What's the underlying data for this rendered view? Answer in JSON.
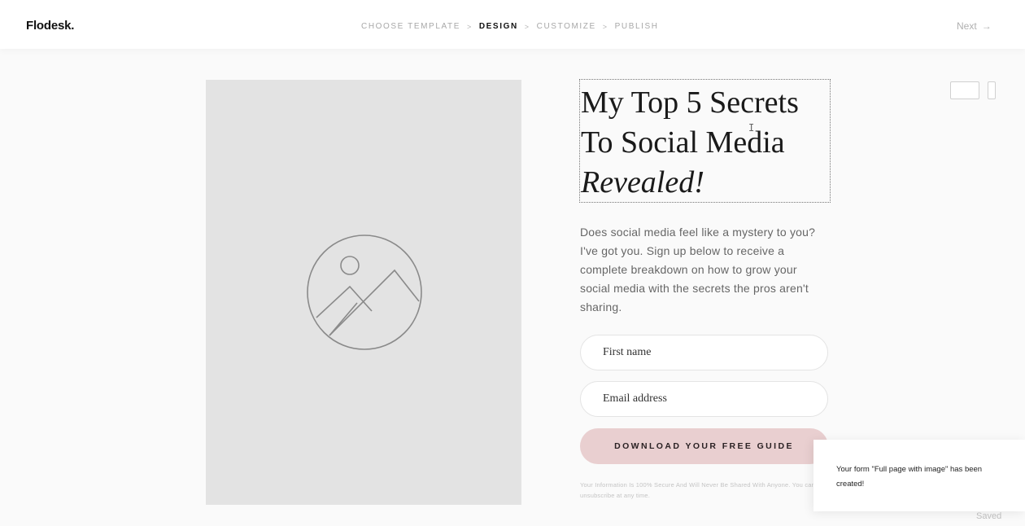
{
  "header": {
    "logo": "Flodesk.",
    "steps": [
      "CHOOSE TEMPLATE",
      "DESIGN",
      "CUSTOMIZE",
      "PUBLISH"
    ],
    "active_step": "DESIGN",
    "separator": ">",
    "next_label": "Next",
    "next_icon": "→"
  },
  "form": {
    "headline_line1": "My Top 5 Secrets",
    "headline_line2": "To Social Media",
    "headline_italic": "Revealed!",
    "body": "Does social media feel like a mystery to you? I've got you. Sign up below to receive a complete breakdown on how to grow your social media with the secrets the pros aren't sharing.",
    "first_name_placeholder": "First name",
    "email_placeholder": "Email address",
    "cta_label": "DOWNLOAD YOUR FREE GUIDE",
    "disclaimer": "Your Information Is 100% Secure And Will Never Be Shared With Anyone. You can unsubscribe at any time."
  },
  "toast": {
    "message": "Your form \"Full page with image\" has been created!"
  },
  "status": {
    "saved": "Saved"
  },
  "colors": {
    "accent_button": "#e9cfd0",
    "image_placeholder": "#e3e3e3",
    "background": "#fafafa"
  },
  "icons": {
    "image_placeholder": "image-placeholder-icon",
    "desktop_preview": "desktop-icon",
    "mobile_preview": "mobile-icon",
    "next_arrow": "arrow-right-icon"
  }
}
